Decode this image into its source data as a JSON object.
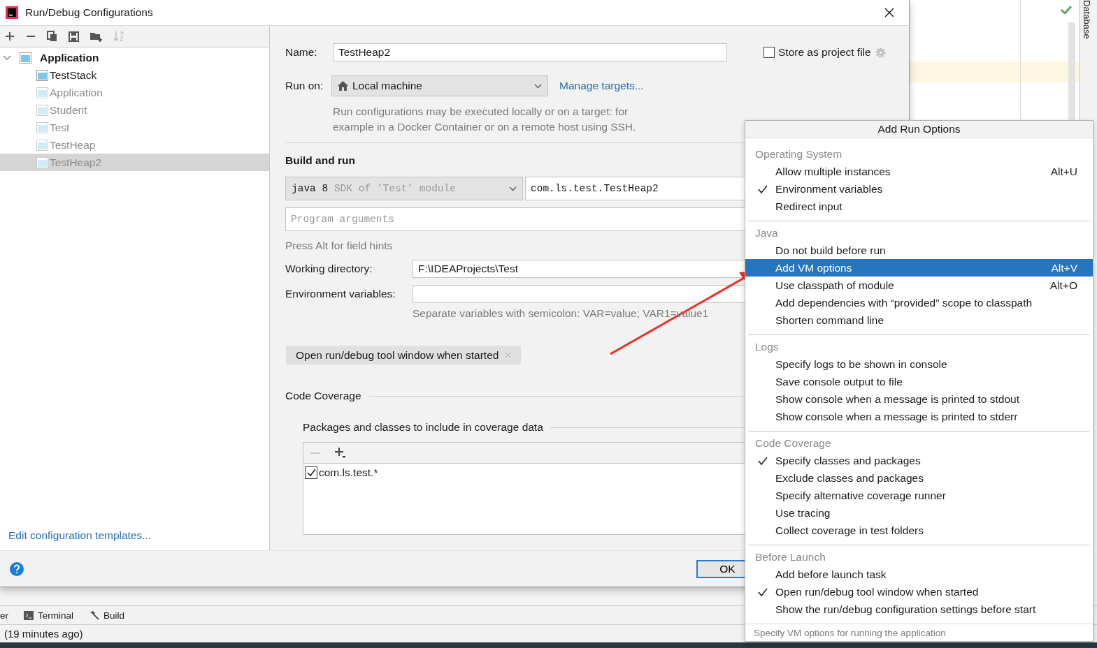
{
  "window": {
    "title": "Run/Debug Configurations"
  },
  "tree": {
    "label": "Application",
    "expanded": true,
    "children": [
      {
        "label": "TestStack",
        "selected": false,
        "disabled": false
      },
      {
        "label": "Application",
        "selected": false,
        "disabled": true
      },
      {
        "label": "Student",
        "selected": false,
        "disabled": true
      },
      {
        "label": "Test",
        "selected": false,
        "disabled": true
      },
      {
        "label": "TestHeap",
        "selected": false,
        "disabled": true
      },
      {
        "label": "TestHeap2",
        "selected": true,
        "disabled": true
      }
    ]
  },
  "templates_link": "Edit configuration templates...",
  "form": {
    "name_label": "Name:",
    "name_value": "TestHeap2",
    "store_label": "Store as project file",
    "store_checked": false,
    "run_on_label": "Run on:",
    "run_on_value": "Local machine",
    "manage_targets": "Manage targets...",
    "run_on_description": "Run configurations may be executed locally or on a target: for example in a Docker Container or on a remote host using SSH.",
    "build_section": "Build and run",
    "sdk_value": "java 8",
    "sdk_hint": "SDK of 'Test' module",
    "main_class": "com.ls.test.TestHeap2",
    "program_args_placeholder": "Program arguments",
    "field_hints": "Press Alt for field hints",
    "working_dir_label": "Working directory:",
    "working_dir_value": "F:\\IDEAProjects\\Test",
    "env_label": "Environment variables:",
    "env_hint": "Separate variables with semicolon: VAR=value; VAR1=value1",
    "tags": [
      "Open run/debug tool window when started"
    ],
    "coverage_section": "Code Coverage",
    "packages_label": "Packages and classes to include in coverage data",
    "packages": [
      {
        "text": "com.ls.test.*",
        "checked": true
      }
    ]
  },
  "buttons": [
    "OK"
  ],
  "popup": {
    "title": "Add Run Options",
    "groups": [
      {
        "header": "Operating System",
        "items": [
          {
            "label": "Allow multiple instances",
            "checked": false,
            "selected": false,
            "shortcut": "Alt+U"
          },
          {
            "label": "Environment variables",
            "checked": true,
            "selected": false
          },
          {
            "label": "Redirect input",
            "checked": false,
            "selected": false
          }
        ]
      },
      {
        "header": "Java",
        "items": [
          {
            "label": "Do not build before run",
            "checked": false,
            "selected": false
          },
          {
            "label": "Add VM options",
            "checked": false,
            "selected": true,
            "shortcut": "Alt+V"
          },
          {
            "label": "Use classpath of module",
            "checked": false,
            "selected": false,
            "shortcut": "Alt+O"
          },
          {
            "label": "Add dependencies with “provided” scope to classpath",
            "checked": false,
            "selected": false
          },
          {
            "label": "Shorten command line",
            "checked": false,
            "selected": false
          }
        ]
      },
      {
        "header": "Logs",
        "items": [
          {
            "label": "Specify logs to be shown in console",
            "checked": false,
            "selected": false
          },
          {
            "label": "Save console output to file",
            "checked": false,
            "selected": false
          },
          {
            "label": "Show console when a message is printed to stdout",
            "checked": false,
            "selected": false
          },
          {
            "label": "Show console when a message is printed to stderr",
            "checked": false,
            "selected": false
          }
        ]
      },
      {
        "header": "Code Coverage",
        "items": [
          {
            "label": "Specify classes and packages",
            "checked": true,
            "selected": false
          },
          {
            "label": "Exclude classes and packages",
            "checked": false,
            "selected": false
          },
          {
            "label": "Specify alternative coverage runner",
            "checked": false,
            "selected": false
          },
          {
            "label": "Use tracing",
            "checked": false,
            "selected": false
          },
          {
            "label": "Collect coverage in test folders",
            "checked": false,
            "selected": false
          }
        ]
      },
      {
        "header": "Before Launch",
        "items": [
          {
            "label": "Add before launch task",
            "checked": false,
            "selected": false
          },
          {
            "label": "Open run/debug tool window when started",
            "checked": true,
            "selected": false
          },
          {
            "label": "Show the run/debug configuration settings before start",
            "checked": false,
            "selected": false
          }
        ]
      }
    ],
    "footer": "Specify VM options for running the application"
  },
  "ide": {
    "side_tab": "Database",
    "tool_tabs": [
      {
        "label": "er",
        "kind": "cut"
      },
      {
        "label": "Terminal",
        "kind": "terminal"
      },
      {
        "label": "Build",
        "kind": "build"
      }
    ],
    "status": "(19 minutes ago)"
  }
}
